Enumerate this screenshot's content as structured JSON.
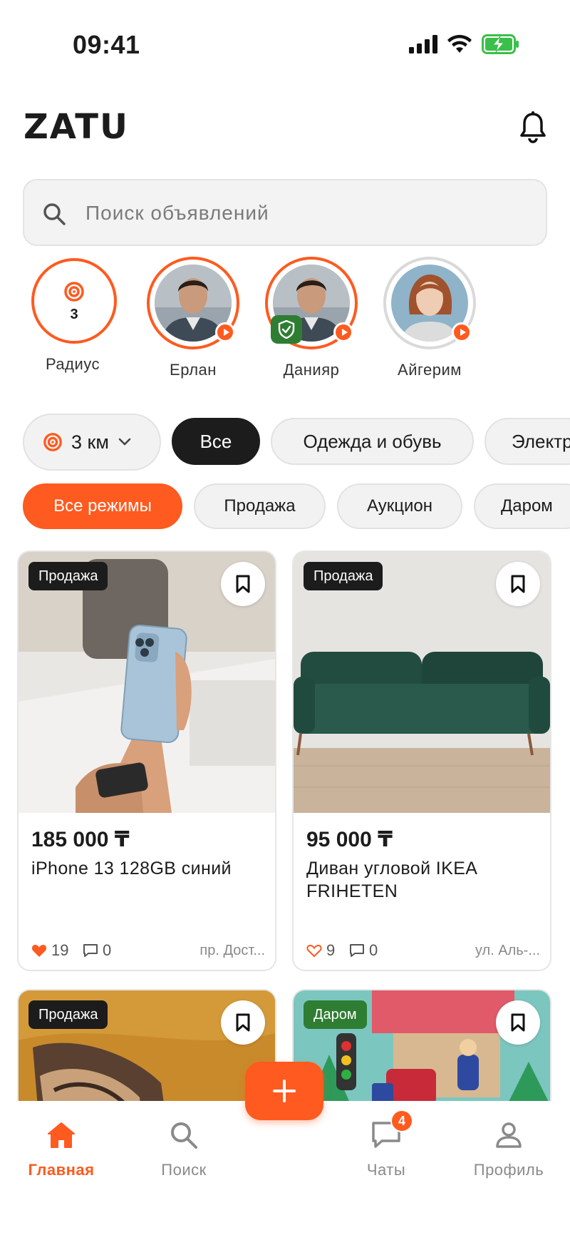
{
  "status_bar": {
    "time": "09:41"
  },
  "header": {
    "logo": "ZATU"
  },
  "search": {
    "placeholder": "Поиск объявлений"
  },
  "stories": {
    "radius": {
      "value": "3",
      "label": "Радиус"
    },
    "items": [
      {
        "name": "Ерлан"
      },
      {
        "name": "Данияр"
      },
      {
        "name": "Айгерим"
      }
    ]
  },
  "category_chips": {
    "distance": "3 км",
    "items": [
      "Все",
      "Одежда и обувь",
      "Электр"
    ]
  },
  "mode_chips": {
    "items": [
      "Все режимы",
      "Продажа",
      "Аукцион",
      "Даром"
    ]
  },
  "listings": [
    {
      "badge": "Продажа",
      "price": "185 000 ₸",
      "title": "iPhone 13 128GB синий",
      "likes": "19",
      "comments": "0",
      "address": "пр. Дост..."
    },
    {
      "badge": "Продажа",
      "price": "95 000 ₸",
      "title": "Диван угловой IKEA FRIHETEN",
      "likes": "9",
      "comments": "0",
      "address": "ул. Аль-..."
    },
    {
      "badge": "Продажа"
    },
    {
      "badge": "Даром"
    }
  ],
  "bottom_nav": {
    "items": [
      {
        "label": "Главная"
      },
      {
        "label": "Поиск"
      },
      {
        "label": "Чаты",
        "badge": "4"
      },
      {
        "label": "Профиль"
      }
    ]
  },
  "colors": {
    "accent": "#ff5a1f",
    "dark": "#1c1c1c",
    "verified": "#2e7d32"
  }
}
